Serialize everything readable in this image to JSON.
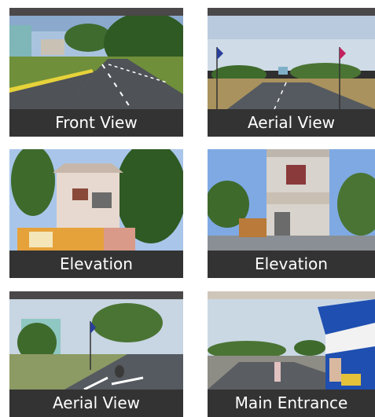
{
  "gallery": {
    "items": [
      {
        "caption": "Front View",
        "icon": "road-photo"
      },
      {
        "caption": "Aerial View",
        "icon": "plot-flags-photo"
      },
      {
        "caption": "Elevation",
        "icon": "house-elevation-photo"
      },
      {
        "caption": "Elevation",
        "icon": "house-elevation-photo"
      },
      {
        "caption": "Aerial View",
        "icon": "layout-road-photo"
      },
      {
        "caption": "Main Entrance",
        "icon": "entrance-tent-photo"
      }
    ]
  },
  "colors": {
    "caption_bg": "#333333",
    "caption_text": "#ffffff",
    "sky": "#9fc1e6",
    "road": "#4f5257",
    "grass": "#6f8f3a"
  }
}
